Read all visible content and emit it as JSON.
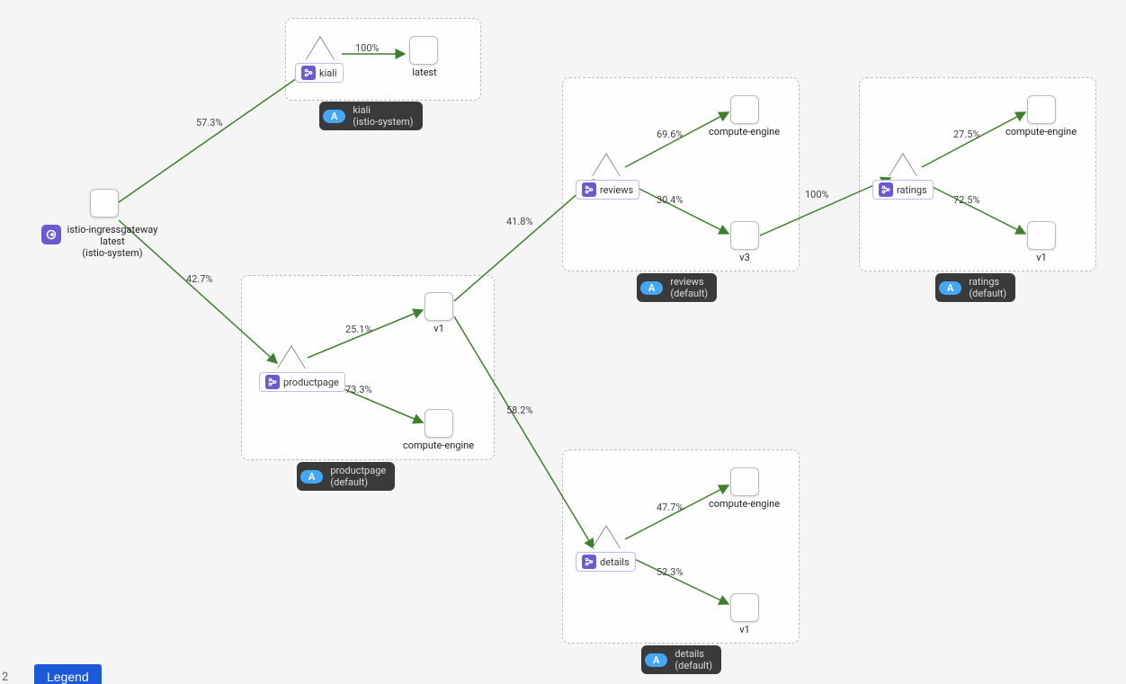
{
  "colors": {
    "edge": "#3e7f2d",
    "group_caption_bg": "#3a3a3a",
    "badge": "#45a7f5",
    "vs": "#6a5acd"
  },
  "origin": {
    "name": "istio-ingressgateway",
    "version": "latest",
    "namespace": "(istio-system)"
  },
  "legend_label": "Legend",
  "corner_counter": "2",
  "groups": [
    {
      "id": "kiali",
      "title": "kiali",
      "namespace": "(istio-system)",
      "badge": "A"
    },
    {
      "id": "productpage",
      "title": "productpage",
      "namespace": "(default)",
      "badge": "A"
    },
    {
      "id": "reviews",
      "title": "reviews",
      "namespace": "(default)",
      "badge": "A"
    },
    {
      "id": "details",
      "title": "details",
      "namespace": "(default)",
      "badge": "A"
    },
    {
      "id": "ratings",
      "title": "ratings",
      "namespace": "(default)",
      "badge": "A"
    }
  ],
  "services": {
    "kiali": {
      "label": "kiali"
    },
    "productpage": {
      "label": "productpage"
    },
    "reviews": {
      "label": "reviews"
    },
    "details": {
      "label": "details"
    },
    "ratings": {
      "label": "ratings"
    }
  },
  "workloads": {
    "kiali_latest": {
      "label": "latest"
    },
    "pp_v1": {
      "label": "v1"
    },
    "pp_ce": {
      "label": "compute-engine"
    },
    "rev_ce": {
      "label": "compute-engine"
    },
    "rev_v3": {
      "label": "v3"
    },
    "det_ce": {
      "label": "compute-engine"
    },
    "det_v1": {
      "label": "v1"
    },
    "rat_ce": {
      "label": "compute-engine"
    },
    "rat_v1": {
      "label": "v1"
    }
  },
  "edges": {
    "ing_kiali": "57.3%",
    "ing_pp": "42.7%",
    "kiali_latest": "100%",
    "pp_v1": "25.1%",
    "pp_ce": "73.3%",
    "v1_reviews": "41.8%",
    "v1_details": "58.2%",
    "rev_ce": "69.6%",
    "rev_v3": "30.4%",
    "v3_ratings": "100%",
    "rat_ce": "27.5%",
    "rat_v1": "72.5%",
    "det_ce": "47.7%",
    "det_v1": "52.3%"
  }
}
